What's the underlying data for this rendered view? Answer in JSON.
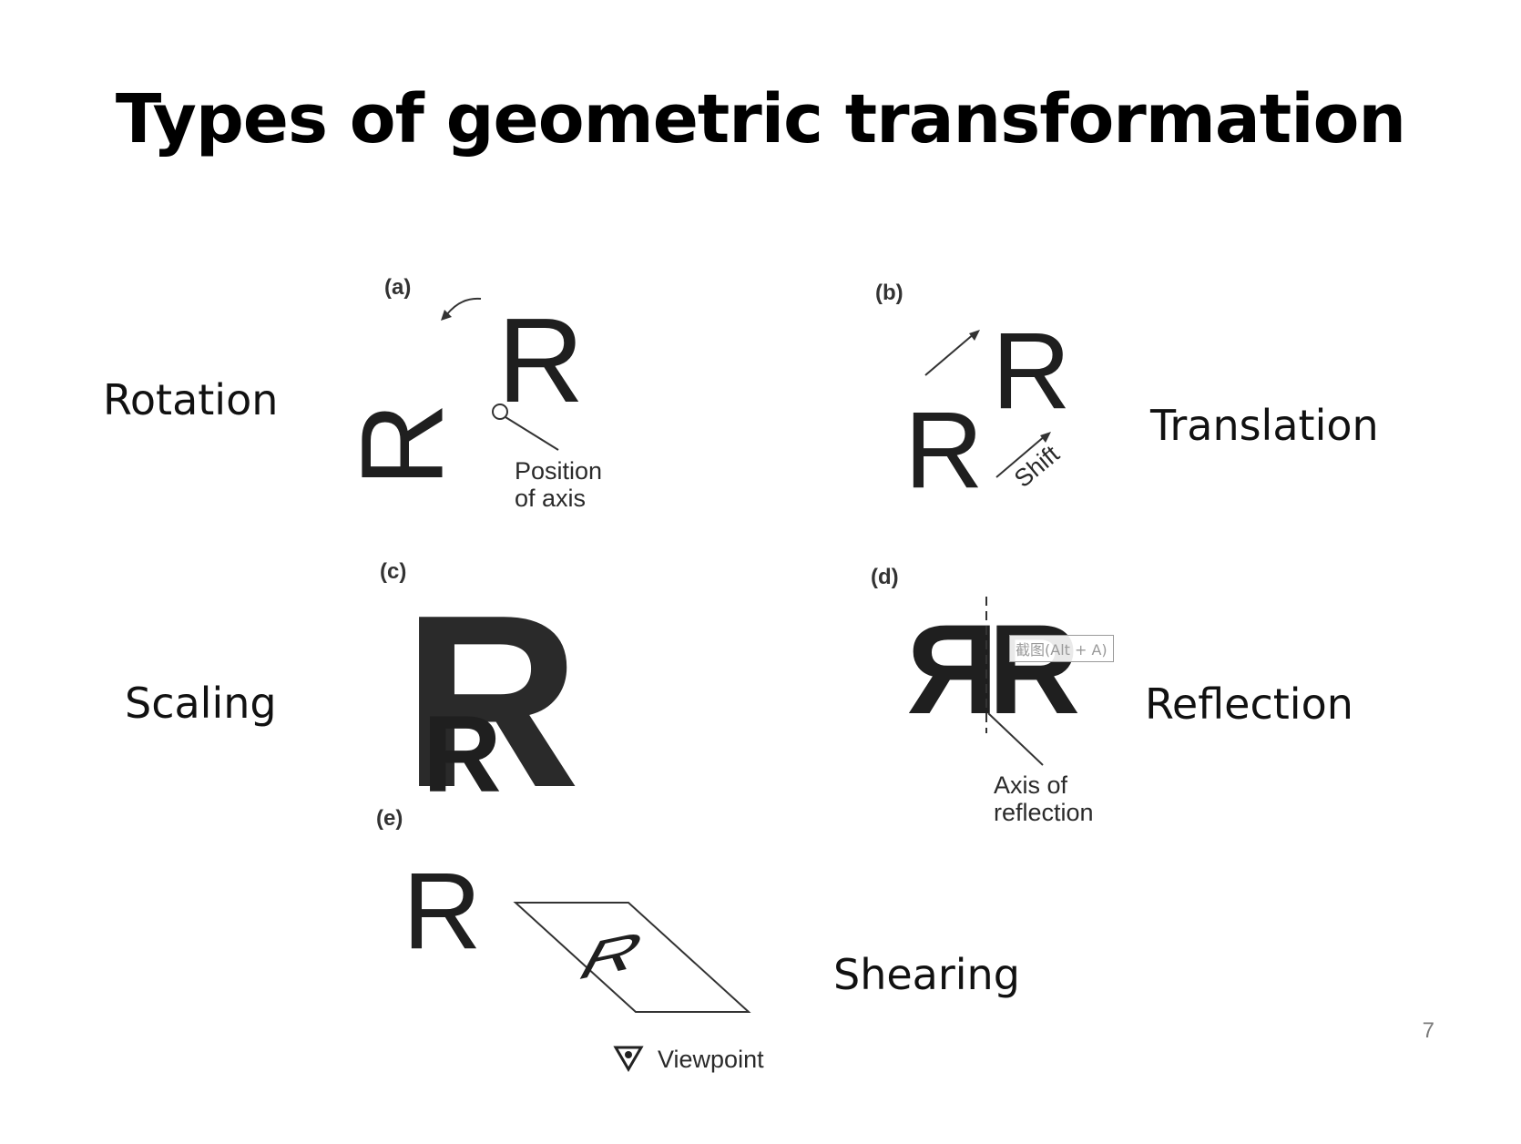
{
  "title": "Types of geometric transformation",
  "transforms": {
    "rotation": "Rotation",
    "translation": "Translation",
    "scaling": "Scaling",
    "reflection": "Reflection",
    "shearing": "Shearing"
  },
  "figure": {
    "panel_a": "(a)",
    "panel_b": "(b)",
    "panel_c": "(c)",
    "panel_d": "(d)",
    "panel_e": "(e)",
    "letter": "R",
    "position_of_axis_line1": "Position",
    "position_of_axis_line2": "of axis",
    "shift": "Shift",
    "axis_of_reflection_line1": "Axis of",
    "axis_of_reflection_line2": "reflection",
    "viewpoint": "Viewpoint"
  },
  "tooltip": "截图(Alt + A)",
  "page_number": "7"
}
